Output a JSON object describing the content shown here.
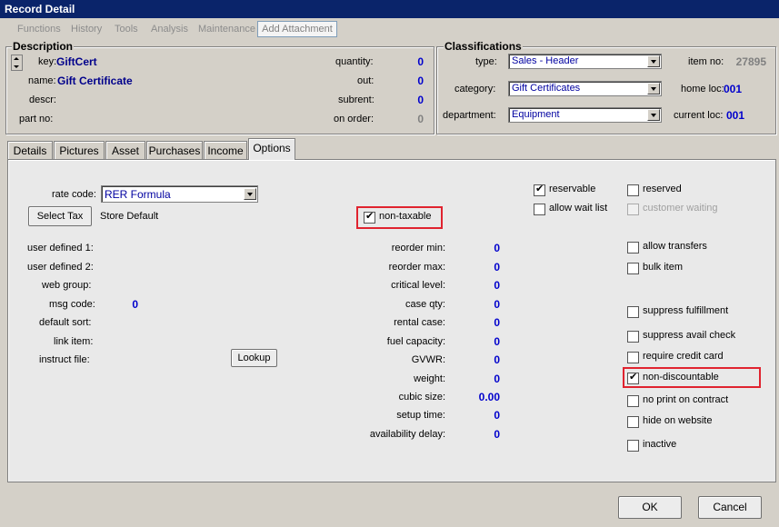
{
  "window": {
    "title": "Record Detail"
  },
  "menu": {
    "items": [
      "Functions",
      "History",
      "Tools",
      "Analysis",
      "Maintenance"
    ],
    "add_attachment": "Add Attachment"
  },
  "description": {
    "title": "Description",
    "key_label": "key:",
    "key_value": "GiftCert",
    "name_label": "name:",
    "name_value": "Gift Certificate",
    "descr_label": "descr:",
    "partno_label": "part no:",
    "quantity_label": "quantity:",
    "quantity_value": "0",
    "out_label": "out:",
    "out_value": "0",
    "subrent_label": "subrent:",
    "subrent_value": "0",
    "onorder_label": "on order:",
    "onorder_value": "0"
  },
  "classifications": {
    "title": "Classifications",
    "type_label": "type:",
    "type_value": "Sales - Header",
    "category_label": "category:",
    "category_value": "Gift Certificates",
    "department_label": "department:",
    "department_value": "Equipment",
    "itemno_label": "item no:",
    "itemno_value": "27895",
    "homeloc_label": "home loc:",
    "homeloc_value": "001",
    "currentloc_label": "current loc:",
    "currentloc_value": "001"
  },
  "tabs": [
    "Details",
    "Pictures",
    "Asset",
    "Purchases",
    "Income",
    "Options"
  ],
  "options": {
    "rate_code_label": "rate code:",
    "rate_code_value": "RER Formula",
    "select_tax_button": "Select Tax",
    "store_default": "Store Default",
    "non_taxable": "non-taxable",
    "user_defined_1": "user defined 1:",
    "user_defined_2": "user defined 2:",
    "web_group": "web group:",
    "msg_code_label": "msg code:",
    "msg_code_value": "0",
    "default_sort": "default sort:",
    "link_item": "link item:",
    "instruct_file": "instruct file:",
    "lookup_button": "Lookup",
    "middle_fields": [
      {
        "label": "reorder min:",
        "value": "0"
      },
      {
        "label": "reorder max:",
        "value": "0"
      },
      {
        "label": "critical level:",
        "value": "0"
      },
      {
        "label": "case qty:",
        "value": "0"
      },
      {
        "label": "rental case:",
        "value": "0"
      },
      {
        "label": "fuel capacity:",
        "value": "0"
      },
      {
        "label": "GVWR:",
        "value": "0"
      },
      {
        "label": "weight:",
        "value": "0"
      },
      {
        "label": "cubic size:",
        "value": "0.00"
      },
      {
        "label": "setup time:",
        "value": "0"
      },
      {
        "label": "availability delay:",
        "value": "0"
      }
    ],
    "checkboxes": {
      "reservable": "reservable",
      "allow_wait_list": "allow wait list",
      "reserved": "reserved",
      "customer_waiting": "customer waiting",
      "allow_transfers": "allow transfers",
      "bulk_item": "bulk item",
      "suppress_fulfillment": "suppress fulfillment",
      "suppress_avail_check": "suppress avail check",
      "require_credit_card": "require credit card",
      "non_discountable": "non-discountable",
      "no_print_on_contract": "no print on contract",
      "hide_on_website": "hide on website",
      "inactive": "inactive"
    }
  },
  "footer": {
    "ok": "OK",
    "cancel": "Cancel"
  },
  "colors": {
    "highlight": "#e0232f",
    "value_blue": "#0000cc",
    "titlebar": "#0a246a"
  }
}
